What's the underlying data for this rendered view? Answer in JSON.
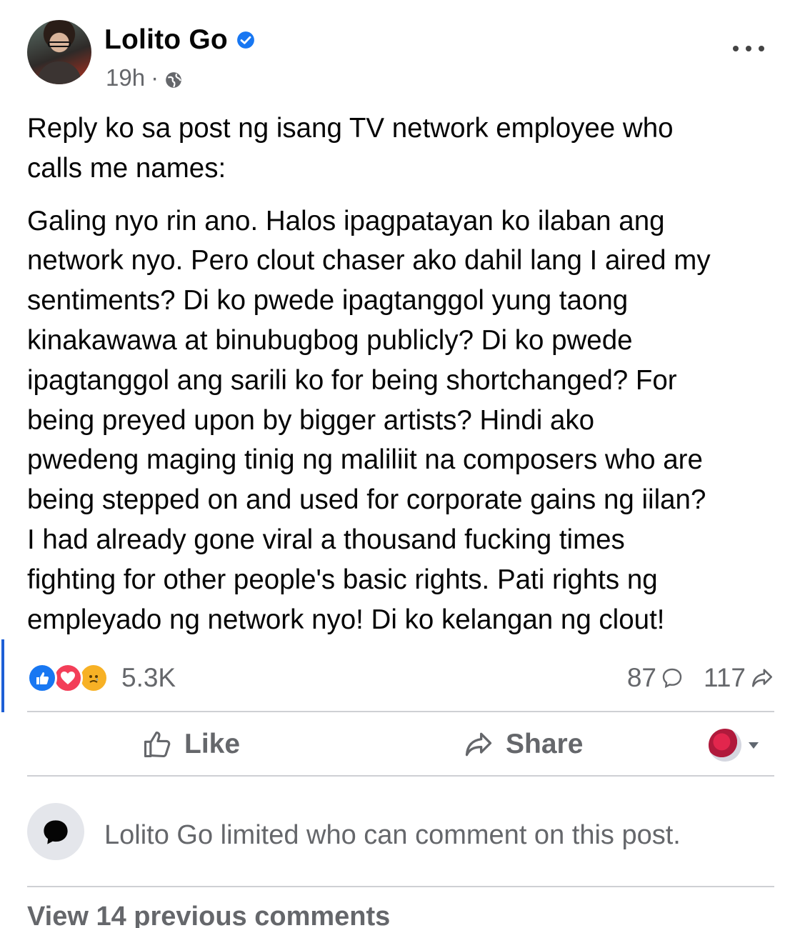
{
  "post": {
    "author": "Lolito Go",
    "time": "19h",
    "meta_separator": "·",
    "paragraphs": [
      "Reply ko sa post ng isang TV network employee who\ncalls me names:",
      "Galing nyo rin ano. Halos ipagpatayan ko ilaban ang\nnetwork nyo. Pero clout chaser ako dahil lang I aired my\nsentiments? Di ko pwede ipagtanggol yung taong\nkinakawawa at binubugbog publicly? Di ko pwede\nipagtanggol ang sarili ko for being shortchanged? For\nbeing preyed upon by bigger artists? Hindi ako\npwedeng maging tinig ng maliliit na composers who are\nbeing stepped on and used for corporate gains ng iilan?\nI had already gone viral a thousand fucking times\nfighting for other people's basic rights. Pati rights ng\nempleyado ng network nyo! Di ko kelangan ng clout!"
    ]
  },
  "stats": {
    "reactions": "5.3K",
    "comments": "87",
    "shares": "117",
    "reaction_types": [
      "like-icon",
      "love-icon",
      "sad-icon"
    ]
  },
  "actions": {
    "like_label": "Like",
    "share_label": "Share"
  },
  "notice": {
    "text": "Lolito Go limited who can comment on this post."
  },
  "comments": {
    "view_previous": "View 14 previous comments"
  },
  "colors": {
    "accent": "#1877f2",
    "secondary_text": "#65676b",
    "love": "#f33e58",
    "sad": "#f7b125",
    "divider": "#ced0d4"
  }
}
